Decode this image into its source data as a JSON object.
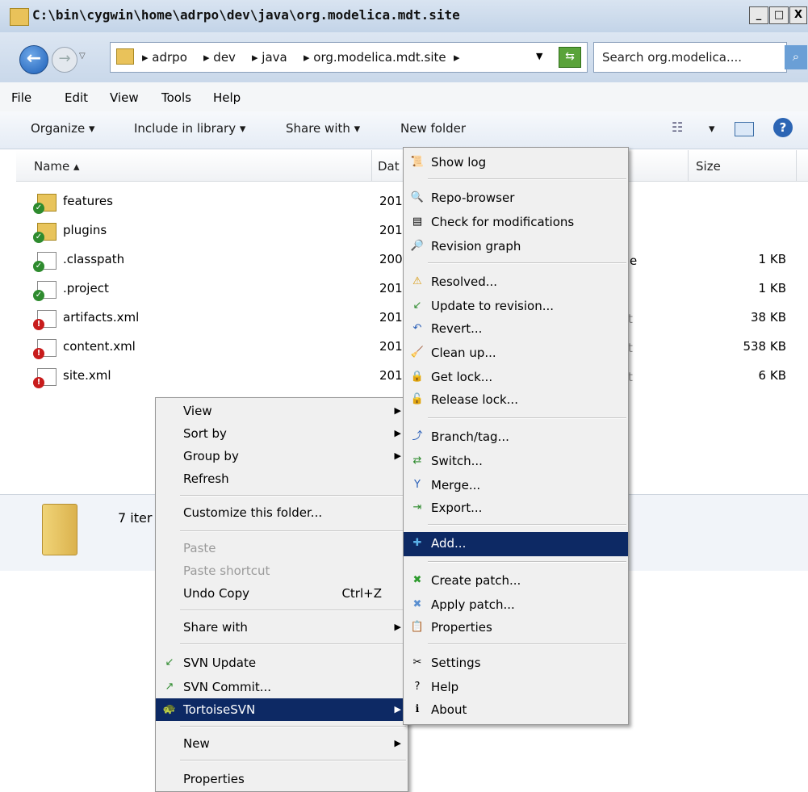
{
  "window": {
    "title": "C:\\bin\\cygwin\\home\\adrpo\\dev\\java\\org.modelica.mdt.site",
    "controls": {
      "minimize": "_",
      "maximize": "□",
      "close": "X"
    }
  },
  "nav": {
    "breadcrumbs": [
      "▸ adrpo",
      "▸ dev",
      "▸ java",
      "▸ org.modelica.mdt.site",
      "▸"
    ],
    "search_placeholder": "Search org.modelica...."
  },
  "menubar": [
    "File",
    "Edit",
    "View",
    "Tools",
    "Help"
  ],
  "toolbar": {
    "organize": "Organize ▾",
    "include": "Include in library ▾",
    "share": "Share with ▾",
    "new_folder": "New folder",
    "view_dd": "▾"
  },
  "columns": {
    "name": "Name ▴",
    "date": "Dat",
    "size": "Size"
  },
  "files": [
    {
      "name": "features",
      "date": "201",
      "size": "",
      "type": "folder",
      "badge": "green"
    },
    {
      "name": "plugins",
      "date": "201",
      "size": "",
      "type": "folder",
      "badge": "green"
    },
    {
      "name": ".classpath",
      "date": "200",
      "size": "1 KB",
      "type": "doc",
      "badge": "green"
    },
    {
      "name": ".project",
      "date": "201",
      "size": "1 KB",
      "type": "doc",
      "badge": "green"
    },
    {
      "name": "artifacts.xml",
      "date": "201",
      "size": "38 KB",
      "type": "doc",
      "badge": "red"
    },
    {
      "name": "content.xml",
      "date": "201",
      "size": "538 KB",
      "type": "doc",
      "badge": "red"
    },
    {
      "name": "site.xml",
      "date": "201",
      "size": "6 KB",
      "type": "doc",
      "badge": "red"
    }
  ],
  "partial_col": {
    "e": "e",
    "t": "t"
  },
  "status": {
    "item_count": "7 iter"
  },
  "context_menu": {
    "view": "View",
    "sort_by": "Sort by",
    "group_by": "Group by",
    "refresh": "Refresh",
    "customize": "Customize this folder...",
    "paste": "Paste",
    "paste_shortcut": "Paste shortcut",
    "undo_copy": "Undo Copy",
    "undo_shortcut": "Ctrl+Z",
    "share_with": "Share with",
    "svn_update": "SVN Update",
    "svn_commit": "SVN Commit...",
    "tortoise": "TortoiseSVN",
    "new": "New",
    "properties": "Properties"
  },
  "svn_menu": {
    "show_log": "Show log",
    "repo_browser": "Repo-browser",
    "check_mod": "Check for modifications",
    "rev_graph": "Revision graph",
    "resolved": "Resolved...",
    "update_rev": "Update to revision...",
    "revert": "Revert...",
    "cleanup": "Clean up...",
    "get_lock": "Get lock...",
    "release_lock": "Release lock...",
    "branch": "Branch/tag...",
    "switch": "Switch...",
    "merge": "Merge...",
    "export": "Export...",
    "add": "Add...",
    "create_patch": "Create patch...",
    "apply_patch": "Apply patch...",
    "properties": "Properties",
    "settings": "Settings",
    "help": "Help",
    "about": "About"
  },
  "colors": {
    "highlight": "#0d2964",
    "menu_bg": "#f0f0f0"
  }
}
